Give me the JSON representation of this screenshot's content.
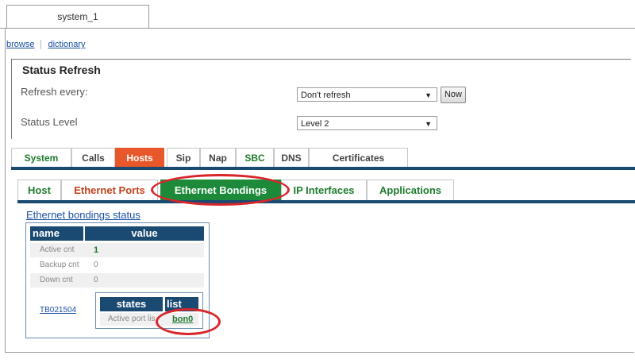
{
  "window": {
    "tab_label": "system_1"
  },
  "links": {
    "browse": "browse",
    "dictionary": "dictionary"
  },
  "status_refresh": {
    "title": "Status Refresh",
    "refresh_label": "Refresh every:",
    "refresh_value": "Don't refresh",
    "now_button": "Now",
    "level_label": "Status Level",
    "level_value": "Level 2"
  },
  "main_tabs": [
    "System",
    "Calls",
    "Hosts",
    "Sip",
    "Nap",
    "SBC",
    "DNS",
    "Certificates"
  ],
  "main_tab_active": "Hosts",
  "sub_tabs": [
    "Host",
    "Ethernet Ports",
    "Ethernet Bondings",
    "IP Interfaces",
    "Applications"
  ],
  "sub_tab_active": "Ethernet Bondings",
  "bondings": {
    "title": "Ethernet bondings status",
    "col_name": "name",
    "col_value": "value",
    "rows": [
      {
        "name": "Active cnt",
        "value": "1"
      },
      {
        "name": "Backup cnt",
        "value": "0"
      },
      {
        "name": "Down cnt",
        "value": "0"
      }
    ],
    "entry_name": "TB021504",
    "states_header": "states",
    "list_header": "list",
    "state_name": "Active port lis",
    "state_value": "bon0"
  },
  "colors": {
    "accent_orange": "#e8572a",
    "accent_green": "#1d8a3a",
    "header_blue": "#1a4a72",
    "annotation_red": "#d8262b"
  }
}
